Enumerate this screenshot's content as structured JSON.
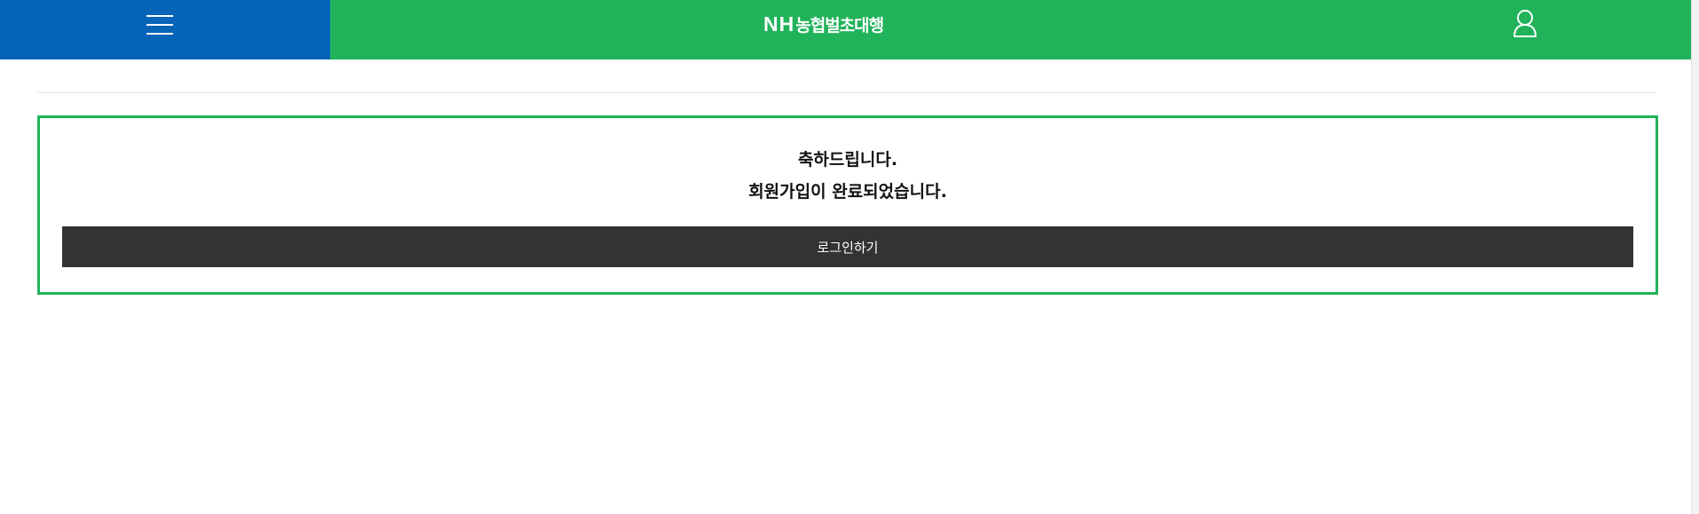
{
  "header": {
    "menu_icon": "hamburger-menu-icon",
    "logo_prefix": "NH",
    "logo_name": "농협벌초대행",
    "user_icon": "user-icon",
    "menu_color": "#0564b8",
    "brand_color": "#20b35a"
  },
  "main": {
    "message_line1": "축하드립니다.",
    "message_line2": "회원가입이 완료되었습니다.",
    "login_button_label": "로그인하기",
    "button_color": "#333333",
    "panel_border_color": "#20b35a"
  }
}
